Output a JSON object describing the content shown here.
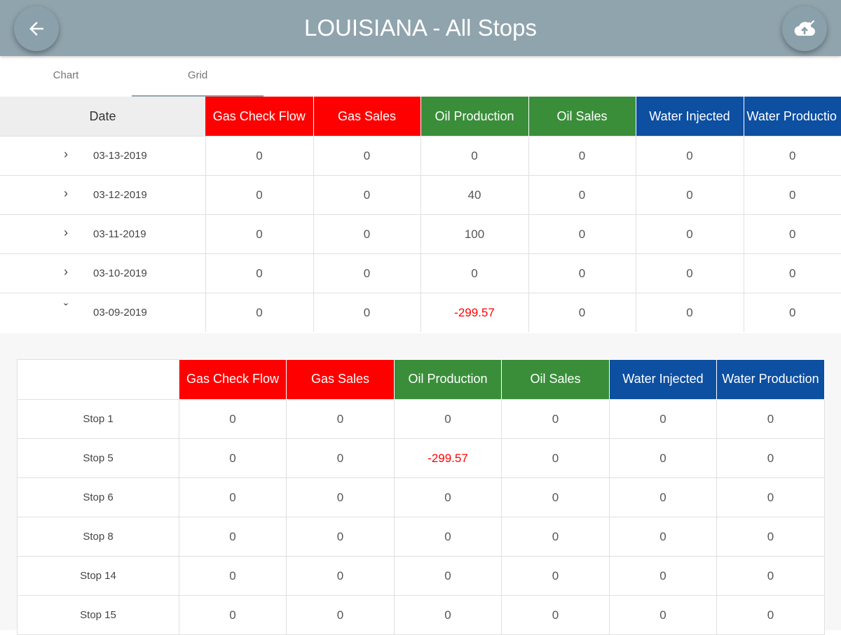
{
  "header": {
    "title": "LOUISIANA - All Stops",
    "back_icon": "arrow-left-icon",
    "action_icon": "cloud-upload-check-icon"
  },
  "tabs": [
    {
      "label": "Chart"
    },
    {
      "label": "Grid"
    }
  ],
  "colors": {
    "topbar": "#90a4ae",
    "red": "#ff0000",
    "green": "#3a8e3a",
    "blue": "#0d4fa0"
  },
  "grid": {
    "date_header": "Date",
    "columns": [
      "Gas Check Flow",
      "Gas Sales",
      "Oil Production",
      "Oil Sales",
      "Water Injected",
      "Water Productio"
    ],
    "rows": [
      {
        "date": "03-13-2019",
        "expanded": false,
        "values": [
          "0",
          "0",
          "0",
          "0",
          "0",
          "0"
        ]
      },
      {
        "date": "03-12-2019",
        "expanded": false,
        "values": [
          "0",
          "0",
          "40",
          "0",
          "0",
          "0"
        ]
      },
      {
        "date": "03-11-2019",
        "expanded": false,
        "values": [
          "0",
          "0",
          "100",
          "0",
          "0",
          "0"
        ]
      },
      {
        "date": "03-10-2019",
        "expanded": false,
        "values": [
          "0",
          "0",
          "0",
          "0",
          "0",
          "0"
        ]
      },
      {
        "date": "03-09-2019",
        "expanded": true,
        "values": [
          "0",
          "0",
          "-299.57",
          "0",
          "0",
          "0"
        ]
      }
    ]
  },
  "detail": {
    "columns": [
      "Gas Check Flow",
      "Gas Sales",
      "Oil Production",
      "Oil Sales",
      "Water Injected",
      "Water Production"
    ],
    "rows": [
      {
        "stop": "Stop 1",
        "values": [
          "0",
          "0",
          "0",
          "0",
          "0",
          "0"
        ]
      },
      {
        "stop": "Stop 5",
        "values": [
          "0",
          "0",
          "-299.57",
          "0",
          "0",
          "0"
        ]
      },
      {
        "stop": "Stop 6",
        "values": [
          "0",
          "0",
          "0",
          "0",
          "0",
          "0"
        ]
      },
      {
        "stop": "Stop 8",
        "values": [
          "0",
          "0",
          "0",
          "0",
          "0",
          "0"
        ]
      },
      {
        "stop": "Stop 14",
        "values": [
          "0",
          "0",
          "0",
          "0",
          "0",
          "0"
        ]
      },
      {
        "stop": "Stop 15",
        "values": [
          "0",
          "0",
          "0",
          "0",
          "0",
          "0"
        ]
      }
    ]
  }
}
